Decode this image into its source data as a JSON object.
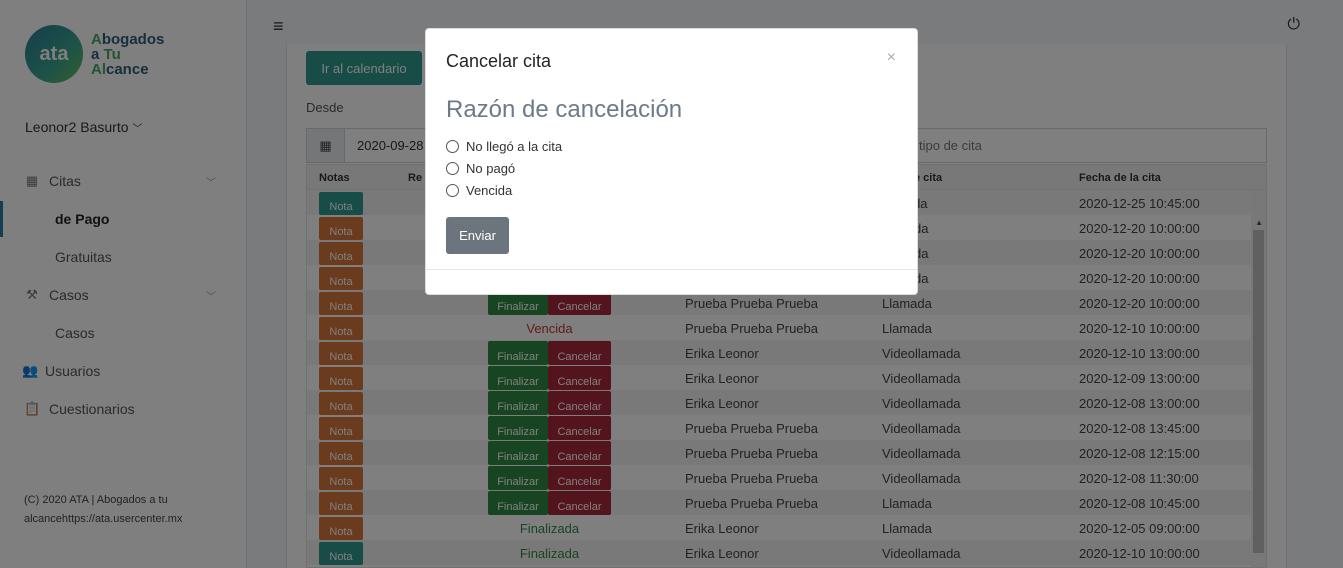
{
  "sidebar": {
    "logo_mark": "ata",
    "logo_line1_a": "A",
    "logo_line1_b": "bogados",
    "logo_line2_a": "a",
    "logo_line2_b": "Tu",
    "logo_line3_a": "Al",
    "logo_line3_b": "cance",
    "user": "Leonor2 Basurto",
    "items": [
      {
        "label": "Citas",
        "icon": "calendar-icon"
      },
      {
        "label": "de Pago"
      },
      {
        "label": "Gratuitas"
      },
      {
        "label": "Casos",
        "icon": "gavel-icon"
      },
      {
        "label": "Casos"
      },
      {
        "label": "Usuarios",
        "icon": "users-icon"
      },
      {
        "label": "Cuestionarios",
        "icon": "clipboard-icon"
      }
    ],
    "footer_line1": "(C) 2020 ATA | Abogados a tu",
    "footer_line2a": "alcance",
    "footer_line2b": "https://ata.usercenter.mx"
  },
  "main": {
    "calendar_button": "Ir al calendario",
    "desde_label": "Desde",
    "date_value": "2020-09-28",
    "tipo_placeholder": "tipo de cita",
    "headers": {
      "notas": "Notas",
      "re": "Re",
      "tipo": "e cita",
      "fecha": "Fecha de la cita"
    },
    "nota_label": "Nota",
    "finalizar_label": "Finalizar",
    "cancelar_label": "Cancelar",
    "rows": [
      {
        "color": "teal",
        "action": "hidden",
        "cliente": "",
        "tipo": "llamada",
        "fecha": "2020-12-25 10:45:00"
      },
      {
        "color": "orange",
        "action": "hidden",
        "cliente": "",
        "tipo": "da",
        "fecha": "2020-12-20 10:00:00"
      },
      {
        "color": "orange",
        "action": "hidden",
        "cliente": "",
        "tipo": "da",
        "fecha": "2020-12-20 10:00:00"
      },
      {
        "color": "orange",
        "action": "hidden",
        "cliente": "",
        "tipo": "da",
        "fecha": "2020-12-20 10:00:00"
      },
      {
        "color": "orange",
        "action": "buttons",
        "cliente": "Prueba Prueba Prueba",
        "tipo": "Llamada",
        "fecha": "2020-12-20 10:00:00"
      },
      {
        "color": "orange",
        "action": "Vencida",
        "cliente": "Prueba Prueba Prueba",
        "tipo": "Llamada",
        "fecha": "2020-12-10 10:00:00"
      },
      {
        "color": "orange",
        "action": "buttons",
        "cliente": "Erika Leonor",
        "tipo": "Videollamada",
        "fecha": "2020-12-10 13:00:00"
      },
      {
        "color": "orange",
        "action": "buttons",
        "cliente": "Erika Leonor",
        "tipo": "Videollamada",
        "fecha": "2020-12-09 13:00:00"
      },
      {
        "color": "orange",
        "action": "buttons",
        "cliente": "Erika Leonor",
        "tipo": "Videollamada",
        "fecha": "2020-12-08 13:00:00"
      },
      {
        "color": "orange",
        "action": "buttons",
        "cliente": "Prueba Prueba Prueba",
        "tipo": "Videollamada",
        "fecha": "2020-12-08 13:45:00"
      },
      {
        "color": "orange",
        "action": "buttons",
        "cliente": "Prueba Prueba Prueba",
        "tipo": "Videollamada",
        "fecha": "2020-12-08 12:15:00"
      },
      {
        "color": "orange",
        "action": "buttons",
        "cliente": "Prueba Prueba Prueba",
        "tipo": "Videollamada",
        "fecha": "2020-12-08 11:30:00"
      },
      {
        "color": "orange",
        "action": "buttons",
        "cliente": "Prueba Prueba Prueba",
        "tipo": "Llamada",
        "fecha": "2020-12-08 10:45:00"
      },
      {
        "color": "orange",
        "action": "Finalizada",
        "cliente": "Erika Leonor",
        "tipo": "Llamada",
        "fecha": "2020-12-05 09:00:00"
      },
      {
        "color": "teal",
        "action": "Finalizada",
        "cliente": "Erika Leonor",
        "tipo": "Videollamada",
        "fecha": "2020-12-10 10:00:00"
      }
    ]
  },
  "modal": {
    "title": "Cancelar cita",
    "close": "×",
    "subtitle": "Razón de cancelación",
    "options": [
      "No llegó a la cita",
      "No pagó",
      "Vencida"
    ],
    "submit": "Enviar"
  },
  "colors": {
    "teal": "#2e9a8c",
    "orange": "#d7773a",
    "green": "#2f8a45",
    "red": "#a8283c",
    "gray_button": "#6c757d"
  }
}
